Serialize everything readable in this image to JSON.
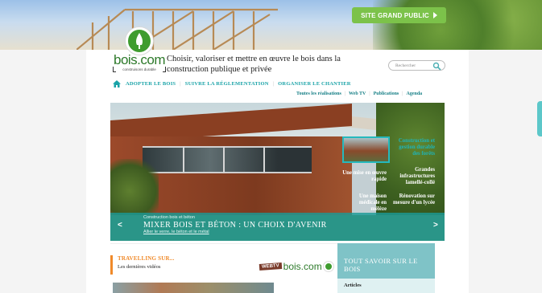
{
  "banner": {
    "cta_label": "SITE GRAND PUBLIC"
  },
  "logo": {
    "name": "bois.com",
    "subtitle": "construisons durable"
  },
  "tagline": "Choisir, valoriser et mettre en œuvre le bois dans la construction publique et privée",
  "search": {
    "placeholder": "Rechercher"
  },
  "nav": {
    "items": [
      {
        "label": "ADOPTER LE BOIS"
      },
      {
        "label": "SUIVRE LA RÉGLEMENTATION"
      },
      {
        "label": "ORGANISER LE CHANTIER"
      }
    ]
  },
  "subnav": {
    "items": [
      {
        "label": "Toutes les réalisations"
      },
      {
        "label": "Web TV"
      },
      {
        "label": "Publications"
      },
      {
        "label": "Agenda"
      }
    ]
  },
  "hero": {
    "pre_title": "Construction bois et béton",
    "title": "MIXER BOIS ET BÉTON : UN CHOIX D'AVENIR",
    "subtitle": "Allier le verre, le béton et le métal",
    "prev_arrow": "<",
    "next_arrow": ">",
    "menu": [
      {
        "label": "Construction et gestion durable des forêts"
      },
      {
        "label": "Une mise en œuvre rapide"
      },
      {
        "label": "Grandes infrastructures lamellé-collé"
      },
      {
        "label": "Une maison médicale en mélèze"
      },
      {
        "label": "Rénovation sur mesure d'un lycée"
      }
    ]
  },
  "travelling": {
    "title": "TRAVELLING SUR...",
    "subtitle": "Les dernières vidéos"
  },
  "webtv": {
    "tag": "WEBTV",
    "brand": "bois.com"
  },
  "savoir": {
    "title": "TOUT SAVOIR SUR LE BOIS",
    "articles_label": "Articles"
  },
  "colors": {
    "teal": "#1aa3a8",
    "green": "#7cc24a",
    "orange": "#f08a2a",
    "logo_green": "#3f9c2f"
  }
}
